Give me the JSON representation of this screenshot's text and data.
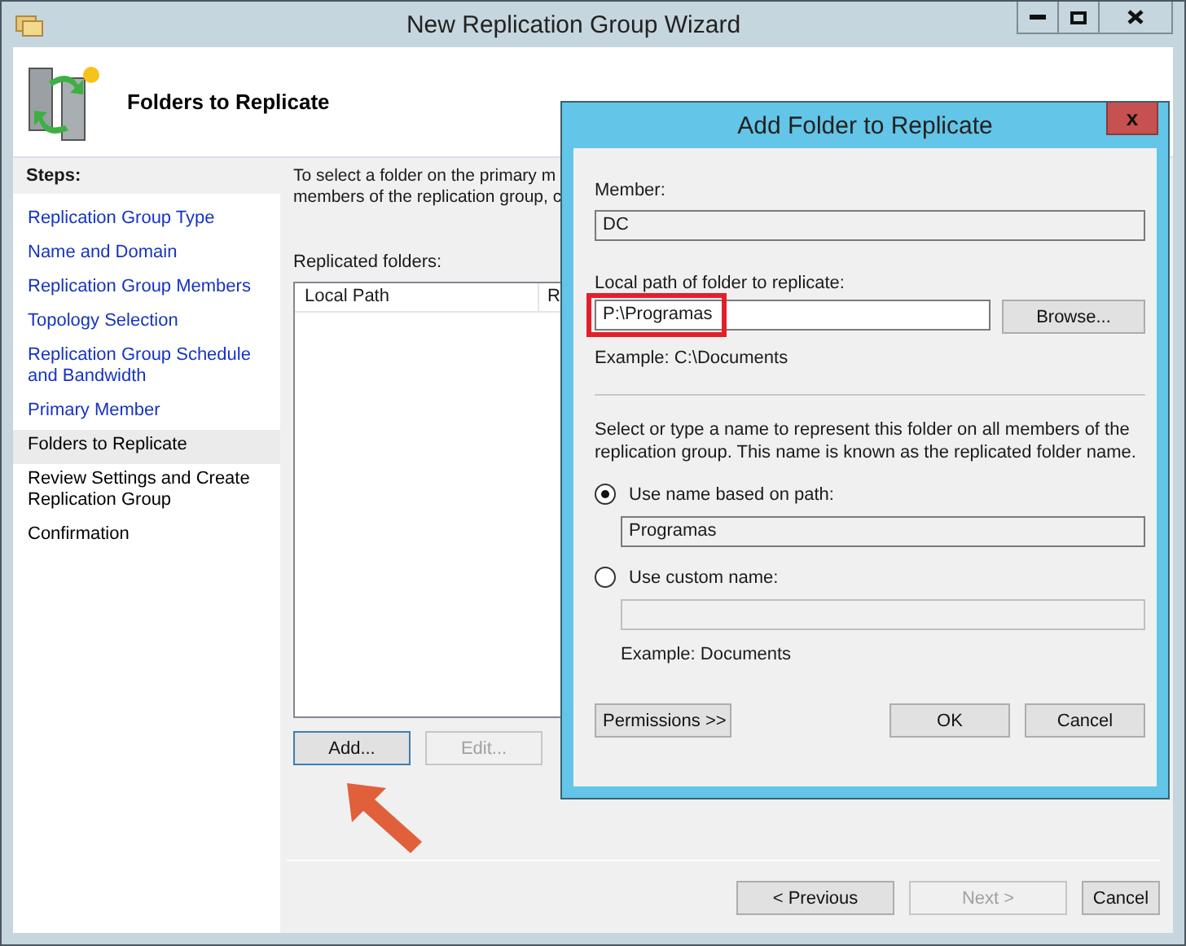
{
  "window": {
    "title": "New Replication Group Wizard",
    "page_title": "Folders to Replicate"
  },
  "steps_heading": "Steps:",
  "steps": [
    {
      "label": "Replication Group Type",
      "visited": true,
      "selected": false
    },
    {
      "label": "Name and Domain",
      "visited": true,
      "selected": false
    },
    {
      "label": "Replication Group Members",
      "visited": true,
      "selected": false
    },
    {
      "label": "Topology Selection",
      "visited": true,
      "selected": false
    },
    {
      "label": "Replication Group Schedule and Bandwidth",
      "visited": true,
      "selected": false
    },
    {
      "label": "Primary Member",
      "visited": true,
      "selected": false
    },
    {
      "label": "Folders to Replicate",
      "visited": false,
      "selected": true
    },
    {
      "label": "Review Settings and Create Replication Group",
      "visited": false,
      "selected": false
    },
    {
      "label": "Confirmation",
      "visited": false,
      "selected": false
    }
  ],
  "instructions": [
    "To select a folder on the primary m",
    "members of the replication group, c"
  ],
  "replicated_folders": {
    "label": "Replicated folders:",
    "columns": [
      {
        "label": "Local Path"
      },
      {
        "label": "R"
      }
    ]
  },
  "list_buttons": [
    {
      "label": "Add...",
      "disabled": false,
      "focused": true
    },
    {
      "label": "Edit...",
      "disabled": true,
      "focused": false
    }
  ],
  "nav_buttons": [
    {
      "label": "< Previous",
      "disabled": false
    },
    {
      "label": "Next >",
      "disabled": true
    },
    {
      "label": "Cancel",
      "disabled": false
    }
  ],
  "dialog": {
    "title": "Add Folder to Replicate",
    "close": "x",
    "member_label": "Member:",
    "member_value": "DC",
    "path_label": "Local path of folder to replicate:",
    "path_value": "P:\\Programas",
    "browse": "Browse...",
    "path_example": "Example: C:\\Documents",
    "description": "Select or type a name to represent this folder on all members of the replication group. This name is known as the replicated folder name.",
    "options": [
      {
        "label": "Use name based on path:",
        "selected": true,
        "value": "Programas"
      },
      {
        "label": "Use custom name:",
        "selected": false,
        "example": "Example: Documents"
      }
    ],
    "buttons": [
      {
        "label": "Permissions >>"
      },
      {
        "label": "OK"
      },
      {
        "label": "Cancel"
      }
    ]
  }
}
